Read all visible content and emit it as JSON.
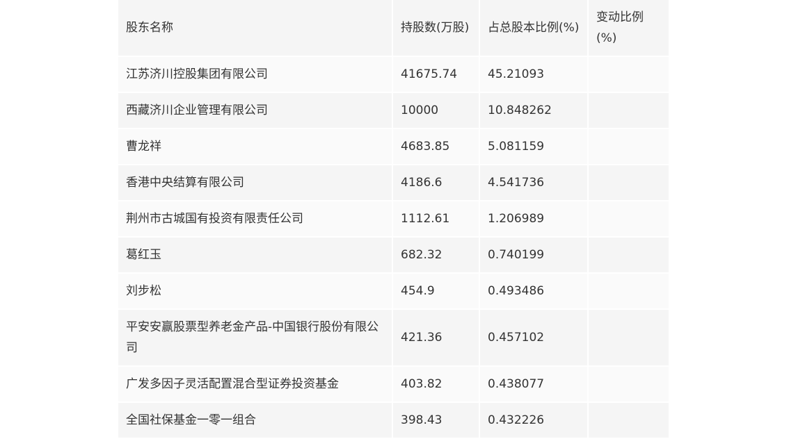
{
  "table": {
    "headers": {
      "name": "股东名称",
      "shares": "持股数(万股)",
      "percent": "占总股本比例(%)",
      "change": "变动比例(%)"
    },
    "rows": [
      {
        "name": "江苏济川控股集团有限公司",
        "shares": "41675.74",
        "percent": "45.21093",
        "change": ""
      },
      {
        "name": "西藏济川企业管理有限公司",
        "shares": "10000",
        "percent": "10.848262",
        "change": ""
      },
      {
        "name": "曹龙祥",
        "shares": "4683.85",
        "percent": "5.081159",
        "change": ""
      },
      {
        "name": "香港中央结算有限公司",
        "shares": "4186.6",
        "percent": "4.541736",
        "change": ""
      },
      {
        "name": "荆州市古城国有投资有限责任公司",
        "shares": "1112.61",
        "percent": "1.206989",
        "change": ""
      },
      {
        "name": "葛红玉",
        "shares": "682.32",
        "percent": "0.740199",
        "change": ""
      },
      {
        "name": "刘步松",
        "shares": "454.9",
        "percent": "0.493486",
        "change": ""
      },
      {
        "name": "平安安赢股票型养老金产品-中国银行股份有限公司",
        "shares": "421.36",
        "percent": "0.457102",
        "change": ""
      },
      {
        "name": "广发多因子灵活配置混合型证券投资基金",
        "shares": "403.82",
        "percent": "0.438077",
        "change": ""
      },
      {
        "name": "全国社保基金一零一组合",
        "shares": "398.43",
        "percent": "0.432226",
        "change": ""
      }
    ]
  }
}
